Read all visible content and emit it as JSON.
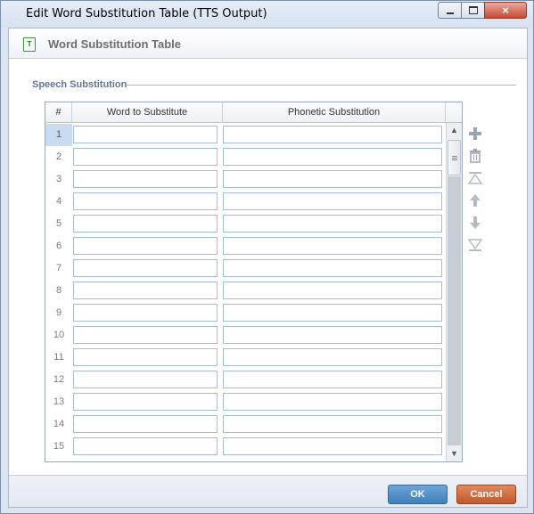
{
  "window": {
    "title": "Edit Word Substitution Table (TTS Output)",
    "minimize": "",
    "maximize": "",
    "close": "×"
  },
  "header": {
    "icon_letter": "T",
    "title": "Word Substitution Table"
  },
  "section": {
    "label": "Speech Substitution"
  },
  "table": {
    "columns": [
      "#",
      "Word to Substitute",
      "Phonetic Substitution"
    ],
    "rows": [
      {
        "num": "1",
        "word": "",
        "phonetic": ""
      },
      {
        "num": "2",
        "word": "",
        "phonetic": ""
      },
      {
        "num": "3",
        "word": "",
        "phonetic": ""
      },
      {
        "num": "4",
        "word": "",
        "phonetic": ""
      },
      {
        "num": "5",
        "word": "",
        "phonetic": ""
      },
      {
        "num": "6",
        "word": "",
        "phonetic": ""
      },
      {
        "num": "7",
        "word": "",
        "phonetic": ""
      },
      {
        "num": "8",
        "word": "",
        "phonetic": ""
      },
      {
        "num": "9",
        "word": "",
        "phonetic": ""
      },
      {
        "num": "10",
        "word": "",
        "phonetic": ""
      },
      {
        "num": "11",
        "word": "",
        "phonetic": ""
      },
      {
        "num": "12",
        "word": "",
        "phonetic": ""
      },
      {
        "num": "13",
        "word": "",
        "phonetic": ""
      },
      {
        "num": "14",
        "word": "",
        "phonetic": ""
      },
      {
        "num": "15",
        "word": "",
        "phonetic": ""
      }
    ],
    "selected_row": "1"
  },
  "toolbar": {
    "icons": [
      "add-icon",
      "delete-icon",
      "move-top-icon",
      "move-up-icon",
      "move-down-icon",
      "move-bottom-icon"
    ]
  },
  "footer": {
    "ok_label": "OK",
    "cancel_label": "Cancel"
  },
  "colors": {
    "ok": "#3f7fb8",
    "cancel": "#c0572a",
    "section_label": "#5f7795",
    "selected_row": "#c9dbf0"
  }
}
